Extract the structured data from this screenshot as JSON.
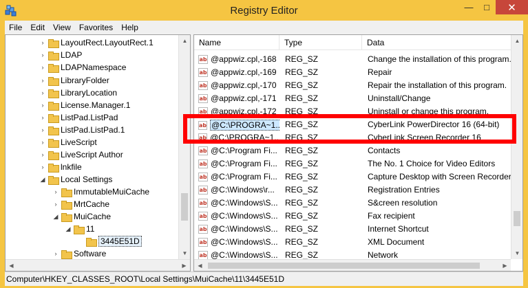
{
  "window": {
    "title": "Registry Editor",
    "minimize": "—",
    "maximize": "□",
    "close": "✕"
  },
  "menu": [
    "File",
    "Edit",
    "View",
    "Favorites",
    "Help"
  ],
  "tree": [
    {
      "label": "LayoutRect.LayoutRect.1",
      "expander": "›"
    },
    {
      "label": "LDAP",
      "expander": "›"
    },
    {
      "label": "LDAPNamespace",
      "expander": "›"
    },
    {
      "label": "LibraryFolder",
      "expander": "›"
    },
    {
      "label": "LibraryLocation",
      "expander": "›"
    },
    {
      "label": "License.Manager.1",
      "expander": "›"
    },
    {
      "label": "ListPad.ListPad",
      "expander": "›"
    },
    {
      "label": "ListPad.ListPad.1",
      "expander": "›"
    },
    {
      "label": "LiveScript",
      "expander": "›"
    },
    {
      "label": "LiveScript Author",
      "expander": "›"
    },
    {
      "label": "lnkfile",
      "expander": "›"
    },
    {
      "label": "Local Settings",
      "expander": "◢"
    },
    {
      "label": "ImmutableMuiCache",
      "expander": "›"
    },
    {
      "label": "MrtCache",
      "expander": "›"
    },
    {
      "label": "MuiCache",
      "expander": "◢"
    },
    {
      "label": "11",
      "expander": "◢"
    },
    {
      "label": "3445E51D",
      "expander": ""
    },
    {
      "label": "Software",
      "expander": "›"
    }
  ],
  "columns": {
    "name": "Name",
    "type": "Type",
    "data": "Data"
  },
  "rows": [
    {
      "name": "@appwiz.cpl,-168",
      "type": "REG_SZ",
      "data": "Change the installation of this program."
    },
    {
      "name": "@appwiz.cpl,-169",
      "type": "REG_SZ",
      "data": "Repair"
    },
    {
      "name": "@appwiz.cpl,-170",
      "type": "REG_SZ",
      "data": "Repair the installation of this program."
    },
    {
      "name": "@appwiz.cpl,-171",
      "type": "REG_SZ",
      "data": "Uninstall/Change"
    },
    {
      "name": "@appwiz.cpl,-172",
      "type": "REG_SZ",
      "data": "Uninstall or change this program."
    },
    {
      "name": "@C:\\PROGRA~1...",
      "type": "REG_SZ",
      "data": "CyberLink PowerDirector 16 (64-bit)"
    },
    {
      "name": "@C:\\PROGRA~1...",
      "type": "REG_SZ",
      "data": "CyberLink Screen Recorder 16"
    },
    {
      "name": "@C:\\Program Fi...",
      "type": "REG_SZ",
      "data": "Contacts"
    },
    {
      "name": "@C:\\Program Fi...",
      "type": "REG_SZ",
      "data": "The No. 1 Choice for Video Editors"
    },
    {
      "name": "@C:\\Program Fi...",
      "type": "REG_SZ",
      "data": "Capture Desktop with Screen Recorder"
    },
    {
      "name": "@C:\\Windows\\r...",
      "type": "REG_SZ",
      "data": "Registration Entries"
    },
    {
      "name": "@C:\\Windows\\S...",
      "type": "REG_SZ",
      "data": "S&creen resolution"
    },
    {
      "name": "@C:\\Windows\\S...",
      "type": "REG_SZ",
      "data": "Fax recipient"
    },
    {
      "name": "@C:\\Windows\\S...",
      "type": "REG_SZ",
      "data": "Internet Shortcut"
    },
    {
      "name": "@C:\\Windows\\S...",
      "type": "REG_SZ",
      "data": "XML Document"
    },
    {
      "name": "@C:\\Windows\\S...",
      "type": "REG_SZ",
      "data": "Network"
    }
  ],
  "row_icon_text": "ab",
  "status": "Computer\\HKEY_CLASSES_ROOT\\Local Settings\\MuiCache\\11\\3445E51D",
  "colors": {
    "frame": "#f5c542",
    "close": "#c7463a",
    "highlight": "#ff0000",
    "selection": "#cde8ff"
  }
}
